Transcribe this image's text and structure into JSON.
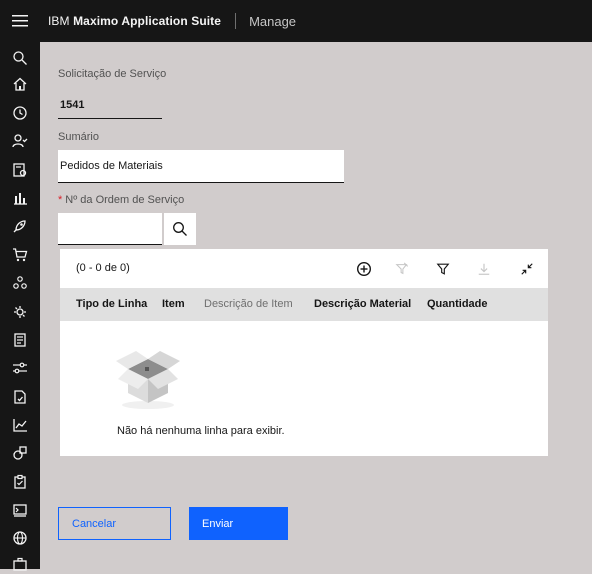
{
  "header": {
    "brand_prefix": "IBM",
    "brand_name": "Maximo Application Suite",
    "app_name": "Manage"
  },
  "sidebar": {
    "icons": [
      "search-icon",
      "home-icon",
      "history-icon",
      "user-check-icon",
      "report-icon",
      "bar-chart-icon",
      "rocket-icon",
      "cart-icon",
      "network-icon",
      "gear-swap-icon",
      "ledger-icon",
      "sliders-icon",
      "document-check-icon",
      "line-chart-icon",
      "shapes-icon",
      "clipboard-icon",
      "terminal-icon",
      "globe-icon",
      "briefcase-icon"
    ]
  },
  "form": {
    "service_request_label": "Solicitação de Serviço",
    "service_request_value": "1541",
    "summary_label": "Sumário",
    "summary_value": "Pedidos de Materiais",
    "work_order_required": "*",
    "work_order_label": "Nº da Ordem de Serviço",
    "work_order_value": ""
  },
  "table": {
    "count": "(0 - 0 de 0)",
    "toolbar_icons": [
      "add-icon",
      "clear-filter-icon",
      "filter-icon",
      "download-icon",
      "collapse-icon"
    ],
    "columns": [
      "Tipo de Linha",
      "Item",
      "Descrição de Item",
      "Descrição Material",
      "Quantidade"
    ],
    "empty_message": "Não há nenhuma linha para exibir."
  },
  "actions": {
    "cancel_label": "Cancelar",
    "submit_label": "Enviar"
  },
  "colors": {
    "accent": "#0f62fe",
    "header_bg": "#161616",
    "page_bg": "#d1cccc",
    "required": "#da1e28"
  }
}
